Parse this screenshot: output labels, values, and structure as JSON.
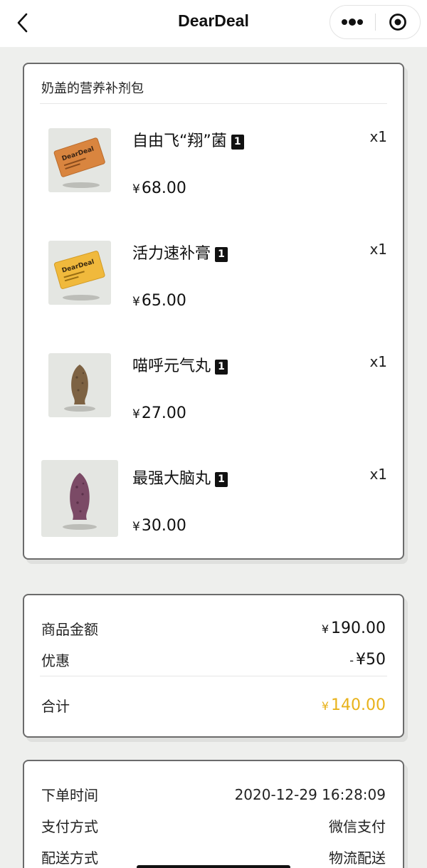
{
  "nav": {
    "title": "DearDeal",
    "back_icon": "chevron-left-icon",
    "more_icon": "more-dots-icon",
    "close_icon": "target-circle-icon"
  },
  "order": {
    "store_name": "奶盖的营养补剂包",
    "items": [
      {
        "name": "自由飞“翔”菌",
        "badge": "1",
        "currency": "¥",
        "price": "68.00",
        "count": "x1",
        "thumb": "orange-packet"
      },
      {
        "name": "活力速补膏",
        "badge": "1",
        "currency": "¥",
        "price": "65.00",
        "count": "x1",
        "thumb": "yellow-packet"
      },
      {
        "name": "喵呼元气丸",
        "badge": "1",
        "currency": "¥",
        "price": "27.00",
        "count": "x1",
        "thumb": "brown-fish-treat"
      },
      {
        "name": "最强大脑丸",
        "badge": "1",
        "currency": "¥",
        "price": "30.00",
        "count": "x1",
        "thumb": "purple-fish-treat"
      }
    ]
  },
  "summary": {
    "goods_label": "商品金额",
    "goods_currency": "¥",
    "goods_value": "190.00",
    "discount_label": "优惠",
    "discount_prefix": "-",
    "discount_currency": "¥",
    "discount_value": "50",
    "total_label": "合计",
    "total_currency": "¥",
    "total_value": "140.00",
    "total_color": "#e8b21a"
  },
  "info": {
    "order_time_label": "下单时间",
    "order_time_value": "2020-12-29 16:28:09",
    "payment_label": "支付方式",
    "payment_value": "微信支付",
    "delivery_label": "配送方式",
    "delivery_value": "物流配送"
  }
}
